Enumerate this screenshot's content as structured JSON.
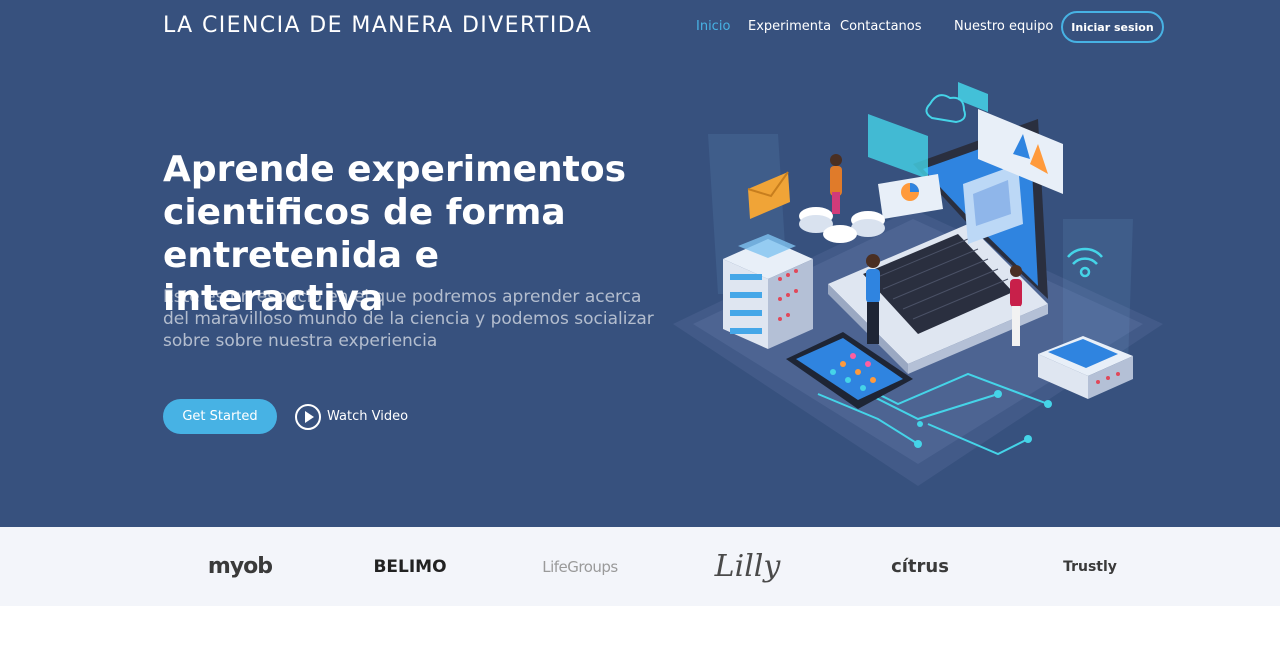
{
  "header": {
    "brand": "LA CIENCIA DE MANERA DIVERTIDA",
    "nav": [
      "Inicio",
      "Experimenta",
      "Contactanos",
      "Nuestro equipo"
    ],
    "login_label": "Iniciar sesion"
  },
  "hero": {
    "title": "Aprende experimentos cientificos de forma entretenida e interactiva",
    "subtitle": "Este es un espacio en el que podremos aprender acerca del maravilloso mundo de la ciencia y podemos socializar sobre sobre nuestra experiencia",
    "cta_label": "Get Started",
    "video_label": "Watch Video"
  },
  "clients": [
    "myob",
    "BELIMO",
    "LifeGroups",
    "Lilly",
    "cítrus",
    "Trustly"
  ],
  "colors": {
    "hero_bg": "#37517e",
    "accent": "#47b2e4",
    "clients_bg": "#f3f5fa"
  }
}
